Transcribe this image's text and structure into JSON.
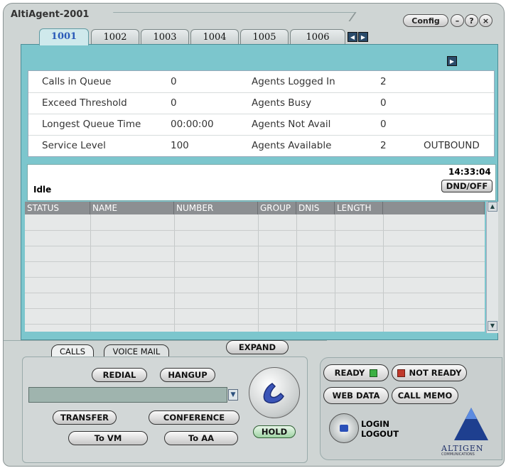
{
  "app": {
    "title": "AltiAgent-2001"
  },
  "titlebar": {
    "config_label": "Config",
    "minimize_glyph": "–",
    "help_glyph": "?",
    "close_glyph": "×"
  },
  "tabs": [
    {
      "label": "1001",
      "active": true
    },
    {
      "label": "1002"
    },
    {
      "label": "1003"
    },
    {
      "label": "1004"
    },
    {
      "label": "1005"
    },
    {
      "label": "1006"
    }
  ],
  "stats": {
    "rows": [
      {
        "label": "Calls in Queue",
        "value": "0",
        "label2": "Agents Logged In",
        "value2": "2",
        "extra": ""
      },
      {
        "label": "Exceed Threshold",
        "value": "0",
        "label2": "Agents Busy",
        "value2": "0",
        "extra": ""
      },
      {
        "label": "Longest Queue Time",
        "value": "00:00:00",
        "label2": "Agents Not Avail",
        "value2": "0",
        "extra": ""
      },
      {
        "label": "Service Level",
        "value": "100",
        "label2": "Agents Available",
        "value2": "2",
        "extra": "OUTBOUND"
      }
    ]
  },
  "status": {
    "state": "Idle",
    "time": "14:33:04",
    "dnd_label": "DND/OFF"
  },
  "calls_table": {
    "columns": [
      "STATUS",
      "NAME",
      "NUMBER",
      "GROUP",
      "DNIS",
      "LENGTH"
    ]
  },
  "lower": {
    "calls_tab": "CALLS",
    "voicemail_tab": "VOICE MAIL",
    "expand": "EXPAND",
    "redial": "REDIAL",
    "hangup": "HANGUP",
    "transfer": "TRANSFER",
    "conference": "CONFERENCE",
    "to_vm": "To VM",
    "to_aa": "To AA",
    "hold": "HOLD",
    "ready": "READY",
    "not_ready": "NOT READY",
    "web_data": "WEB DATA",
    "call_memo": "CALL MEMO",
    "login": "LOGIN",
    "logout": "LOGOUT",
    "logo_text": "ALTIGEN",
    "logo_sub": "COMMUNICATIONS"
  },
  "colors": {
    "accent": "#7cc6cd",
    "active_tab": "#2a5ab8",
    "ready_led": "#3cb043",
    "not_ready_led": "#c0392b"
  }
}
